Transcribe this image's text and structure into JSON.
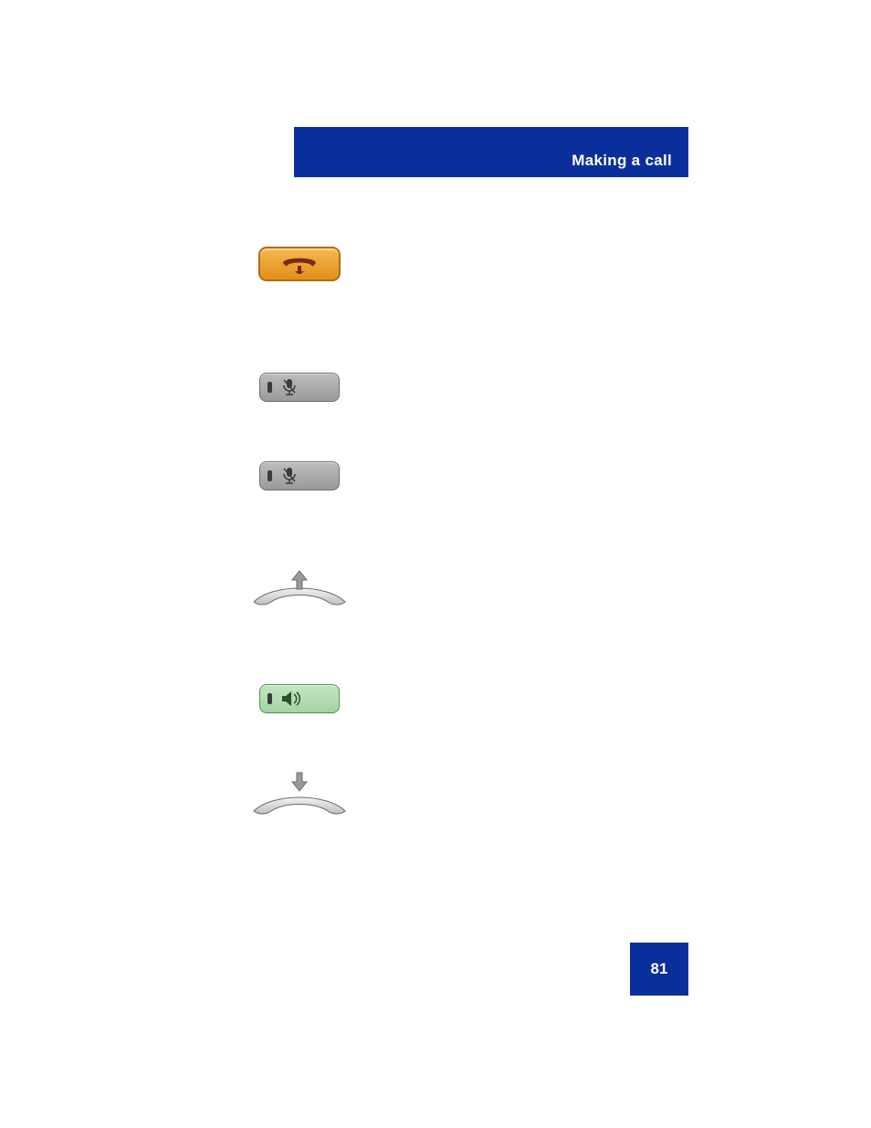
{
  "header": {
    "title": "Making a call"
  },
  "page_number": "81",
  "icons": {
    "goodbye": "goodbye-key",
    "mute": "mute-key",
    "handsfree": "handsfree-key",
    "handset_lift": "lift-handset",
    "handset_replace": "replace-handset"
  }
}
